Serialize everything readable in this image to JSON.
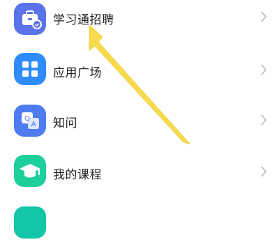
{
  "menu": {
    "items": [
      {
        "label": "学习通招聘",
        "icon": "briefcase-icon",
        "color": "#5B73E8"
      },
      {
        "label": "应用广场",
        "icon": "app-grid-icon",
        "color": "#2F8CFF"
      },
      {
        "label": "知问",
        "icon": "qa-icon",
        "color": "#4F7BF0"
      },
      {
        "label": "我的课程",
        "icon": "graduation-cap-icon",
        "color": "#1ECF9E"
      },
      {
        "label": "",
        "icon": "partial-icon",
        "color": "#14C6A8"
      }
    ]
  },
  "annotation": {
    "arrow_color": "#F7DB4E"
  },
  "qa_icon_text": {
    "q": "Q",
    "a": "A"
  }
}
